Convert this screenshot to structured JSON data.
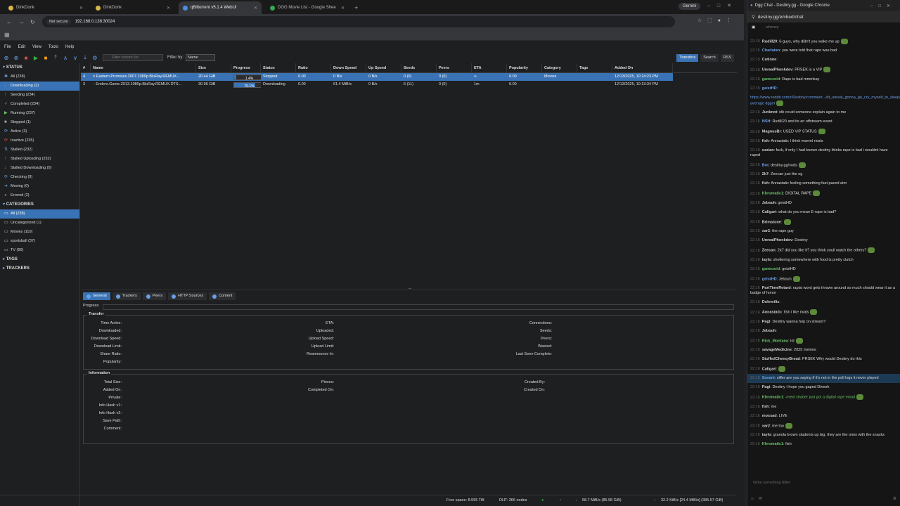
{
  "browser": {
    "tabs": [
      {
        "label": "DinkDonk",
        "color": "#d7b84b"
      },
      {
        "label": "DinkDonk",
        "color": "#d7b84b"
      },
      {
        "label": "qBittorrent v5.1.4 WebUI",
        "color": "#4a90e2",
        "active": true
      },
      {
        "label": "DGG Movie List - Google Shee",
        "color": "#34a853"
      }
    ],
    "new_tab": "+",
    "gemini": "Gemini",
    "not_secure": "Not secure",
    "url": "192.168.0.138:30024"
  },
  "menu": [
    "File",
    "Edit",
    "View",
    "Tools",
    "Help"
  ],
  "toolbar": {
    "filter_placeholder": "Filter torrent list",
    "filter_by_label": "Filter by:",
    "filter_by_value": "Name",
    "right_buttons": [
      "Transfers",
      "Search",
      "RSS"
    ]
  },
  "sidebar": {
    "status_header": "STATUS",
    "status": [
      {
        "label": "All (238)",
        "icon": "all-icon",
        "glyph": "✱",
        "color": "#6aa0e8"
      },
      {
        "label": "Downloading (2)",
        "icon": "download-icon",
        "glyph": "↓",
        "color": "#6ac36a",
        "selected": true
      },
      {
        "label": "Seeding (234)",
        "icon": "upload-icon",
        "glyph": "↑",
        "color": "#6aa0e8"
      },
      {
        "label": "Completed (234)",
        "icon": "check-icon",
        "glyph": "✓",
        "color": "#6aa0e8"
      },
      {
        "label": "Running (237)",
        "icon": "play-icon",
        "glyph": "▶",
        "color": "#6ac36a"
      },
      {
        "label": "Stopped (1)",
        "icon": "stop-icon",
        "glyph": "■",
        "color": "#aaa"
      },
      {
        "label": "Active (3)",
        "icon": "active-icon",
        "glyph": "⟳",
        "color": "#6aa0e8"
      },
      {
        "label": "Inactive (235)",
        "icon": "inactive-icon",
        "glyph": "⟳",
        "color": "#d05050"
      },
      {
        "label": "Stalled (232)",
        "icon": "stalled-icon",
        "glyph": "⇅",
        "color": "#6aa0e8"
      },
      {
        "label": "Stalled Uploading (232)",
        "icon": "stalled-up-icon",
        "glyph": "↑",
        "color": "#6aa0e8"
      },
      {
        "label": "Stalled Downloading (0)",
        "icon": "stalled-down-icon",
        "glyph": "↓",
        "color": "#6ac36a"
      },
      {
        "label": "Checking (0)",
        "icon": "checking-icon",
        "glyph": "⟳",
        "color": "#6aa0e8"
      },
      {
        "label": "Moving (0)",
        "icon": "moving-icon",
        "glyph": "➜",
        "color": "#6aa0e8"
      },
      {
        "label": "Errored (2)",
        "icon": "error-icon",
        "glyph": "●",
        "color": "#d05050"
      }
    ],
    "categories_header": "CATEGORIES",
    "categories": [
      {
        "label": "All (238)",
        "selected": true
      },
      {
        "label": "Uncategorized (1)"
      },
      {
        "label": "Movies (110)"
      },
      {
        "label": "sportsball (37)"
      },
      {
        "label": "TV (90)"
      }
    ],
    "tags_header": "TAGS",
    "trackers_header": "TRACKERS"
  },
  "table": {
    "columns": [
      "#",
      "Name",
      "Size",
      "Progress",
      "Status",
      "Ratio",
      "Down Speed",
      "Up Speed",
      "Seeds",
      "Peers",
      "ETA",
      "Popularity",
      "Category",
      "Tags",
      "Added On"
    ],
    "rows": [
      {
        "num": "4",
        "name": "Eastern.Promises.2007.1080p.BluRay.REMUX...",
        "size": "20.44 GiB",
        "progress": 1.4,
        "progress_text": "1.4%",
        "status": "Stopped",
        "ratio": "0.00",
        "down": "0 B/s",
        "up": "0 B/s",
        "seeds": "0 (0)",
        "peers": "0 (0)",
        "eta": "∞",
        "popularity": "0.00",
        "category": "Movies",
        "tags": "",
        "added": "12/13/2025, 10:14:23 PM",
        "selected": true,
        "icon": "stopped-icon"
      },
      {
        "num": "3",
        "name": "Enders.Game.2013.1080p.BluRay.REMUX.DTS...",
        "size": "30.96 GiB",
        "progress": 76.1,
        "progress_text": "76.1%",
        "status": "Downloading",
        "ratio": "0.00",
        "down": "61.4 MiB/s",
        "up": "0 B/s",
        "seeds": "5 (11)",
        "peers": "0 (0)",
        "eta": "1m",
        "popularity": "0.00",
        "category": "",
        "tags": "",
        "added": "12/13/2025, 10:13:34 PM",
        "selected": false,
        "icon": "downloading-icon"
      }
    ]
  },
  "panel": {
    "tabs": [
      "General",
      "Trackers",
      "Peers",
      "HTTP Sources",
      "Content"
    ],
    "progress_label": "Progress:",
    "transfer_legend": "Transfer",
    "transfer_col1": [
      "Time Active:",
      "Downloaded:",
      "Download Speed:",
      "Download Limit:",
      "Share Ratio:",
      "Popularity:"
    ],
    "transfer_col2": [
      "ETA:",
      "Uploaded:",
      "Upload Speed:",
      "Upload Limit:",
      "Reannounce In:"
    ],
    "transfer_col3": [
      "Connections:",
      "Seeds:",
      "Peers:",
      "Wasted:",
      "Last Seen Complete:"
    ],
    "info_legend": "Information",
    "info_col1": [
      "Total Size:",
      "Added On:",
      "Private:",
      "Info Hash v1:",
      "Info Hash v2:",
      "Save Path:",
      "Comment:"
    ],
    "info_col2": [
      "Pieces:",
      "Completed On:"
    ],
    "info_col3": [
      "Created By:",
      "Created On:"
    ]
  },
  "statusbar": {
    "free_space": "Free space: 8.555 TiB",
    "dht": "DHT: 366 nodes",
    "down": "58.7 MiB/s (85.98 GiB)",
    "up": "32.2 KiB/s [24.4 MiB/s] (385.57 GiB)"
  },
  "chat": {
    "window_title": "Dgg Chat - Destiny.gg - Google Chrome",
    "url": "destiny.gg/embed/chat",
    "top_label": "whenzy",
    "input_placeholder": "Write something 8ifter",
    "messages": [
      {
        "ts": "22:15",
        "user": "RudiII20",
        "text": " 6-guys, why didn't you wake me up",
        "uc": ""
      },
      {
        "ts": "22:15",
        "user": "Charlatan",
        "text": " you were told that rape was bad",
        "uc": "b"
      },
      {
        "ts": "22:15",
        "user": "Cotlone",
        "text": "",
        "uc": ""
      },
      {
        "ts": "22:15",
        "user": "UnrealPhonkdev",
        "text": " PRSEK is a VIP",
        "uc": ""
      },
      {
        "ts": "22:15",
        "user": "gamezoid",
        "text": " Rape is bad mmmkay",
        "uc": "g"
      },
      {
        "ts": "22:15",
        "user": "geistHD",
        "text": "",
        "uc": "b"
      },
      {
        "ts": "",
        "user": "",
        "text": "https://www.reddit.com/r/Destiny/comment...elt_unreal_gonna_go_cry_myself_to_sleep/ average dgger",
        "uc": "",
        "link": true
      },
      {
        "ts": "22:16",
        "user": "Junknot",
        "text": " idk could someone explain again to me",
        "uc": ""
      },
      {
        "ts": "22:16",
        "user": "NSH",
        "text": " RudiII20 and its an offstream event",
        "uc": "b"
      },
      {
        "ts": "22:16",
        "user": "MagnusBr",
        "text": " USED VIP STATUS",
        "uc": ""
      },
      {
        "ts": "22:16",
        "user": "fish",
        "text": " Annastatic I think marvel rivals",
        "uc": ""
      },
      {
        "ts": "22:16",
        "user": "ozzian",
        "text": " fuck, if only I had known destiny thinks rape is bad i wouldnt have raped",
        "uc": ""
      },
      {
        "ts": "22:16",
        "user": "Bot",
        "text": " destiny.gg/vods",
        "uc": "b"
      },
      {
        "ts": "22:16",
        "user": "2k7",
        "text": " Zeecan just the og",
        "uc": ""
      },
      {
        "ts": "22:16",
        "user": "fish",
        "text": " Annastatic feeling something fast paced atm",
        "uc": ""
      },
      {
        "ts": "22:16",
        "user": "Khromatic1",
        "text": " DIGITAL RAPE",
        "uc": "g"
      },
      {
        "ts": "22:16",
        "user": "Jebouh",
        "text": " geistHD",
        "uc": ""
      },
      {
        "ts": "22:16",
        "user": "Caligari",
        "text": " what do you mean E-rape is bad?",
        "uc": ""
      },
      {
        "ts": "22:16",
        "user": "Brimstone",
        "text": "",
        "uc": ""
      },
      {
        "ts": "22:16",
        "user": "xar2",
        "text": " the rape guy",
        "uc": ""
      },
      {
        "ts": "22:16",
        "user": "UnrealPhonkdev",
        "text": " Destiny",
        "uc": ""
      },
      {
        "ts": "22:16",
        "user": "Zeecan",
        "text": " 2k7 did you like it? you think youll watch the others?",
        "uc": ""
      },
      {
        "ts": "22:16",
        "user": "taylo",
        "text": " sheltering somewhere with food is pretty clutch",
        "uc": ""
      },
      {
        "ts": "22:16",
        "user": "gamezoid",
        "text": " geistHD",
        "uc": "g"
      },
      {
        "ts": "22:16",
        "user": "geistHD",
        "text": " Jebouh",
        "uc": "b"
      },
      {
        "ts": "22:16",
        "user": "PartTimeRetard",
        "text": " rapist word gets thrown around so much should wear it as a badge of honor",
        "uc": ""
      },
      {
        "ts": "22:16",
        "user": "Dolemilis",
        "text": "",
        "uc": ""
      },
      {
        "ts": "22:16",
        "user": "Annastatic",
        "text": " fish i like rivals",
        "uc": ""
      },
      {
        "ts": "22:16",
        "user": "Pagi",
        "text": " Destiny wanna hop on stream?",
        "uc": ""
      },
      {
        "ts": "22:16",
        "user": "Jebouh",
        "text": "",
        "uc": ""
      },
      {
        "ts": "22:16",
        "user": "Rick_Montana",
        "text": " lol",
        "uc": "g"
      },
      {
        "ts": "22:16",
        "user": "savageMedicine",
        "text": " 2025 memes",
        "uc": ""
      },
      {
        "ts": "22:16",
        "user": "StuffedCheesyBread",
        "text": " PRSEK Why would Destiny do this",
        "uc": ""
      },
      {
        "ts": "22:16",
        "user": "Caligari",
        "text": "",
        "uc": ""
      },
      {
        "ts": "22:16",
        "user": "Savant",
        "text": " siffer are you saying if it's not in the poll logs it never played",
        "uc": "b",
        "hl": true
      },
      {
        "ts": "22:16",
        "user": "Pagi",
        "text": " Destiny I hope you gaped Dinesh",
        "uc": ""
      },
      {
        "ts": "22:16",
        "user": "Khromatic1",
        "text": " >next chatter just got a digital rape email",
        "uc": "g",
        "green": true
      },
      {
        "ts": "22:16",
        "user": "fish",
        "text": " me",
        "uc": ""
      },
      {
        "ts": "22:16",
        "user": "mossad",
        "text": " LIVE",
        "uc": ""
      },
      {
        "ts": "22:16",
        "user": "xar2",
        "text": " me too",
        "uc": ""
      },
      {
        "ts": "22:16",
        "user": "taylo",
        "text": " granola brown students up big. they are the ones with the snacks",
        "uc": ""
      },
      {
        "ts": "22:16",
        "user": "Khromatic1",
        "text": " fish",
        "uc": "g"
      }
    ]
  }
}
